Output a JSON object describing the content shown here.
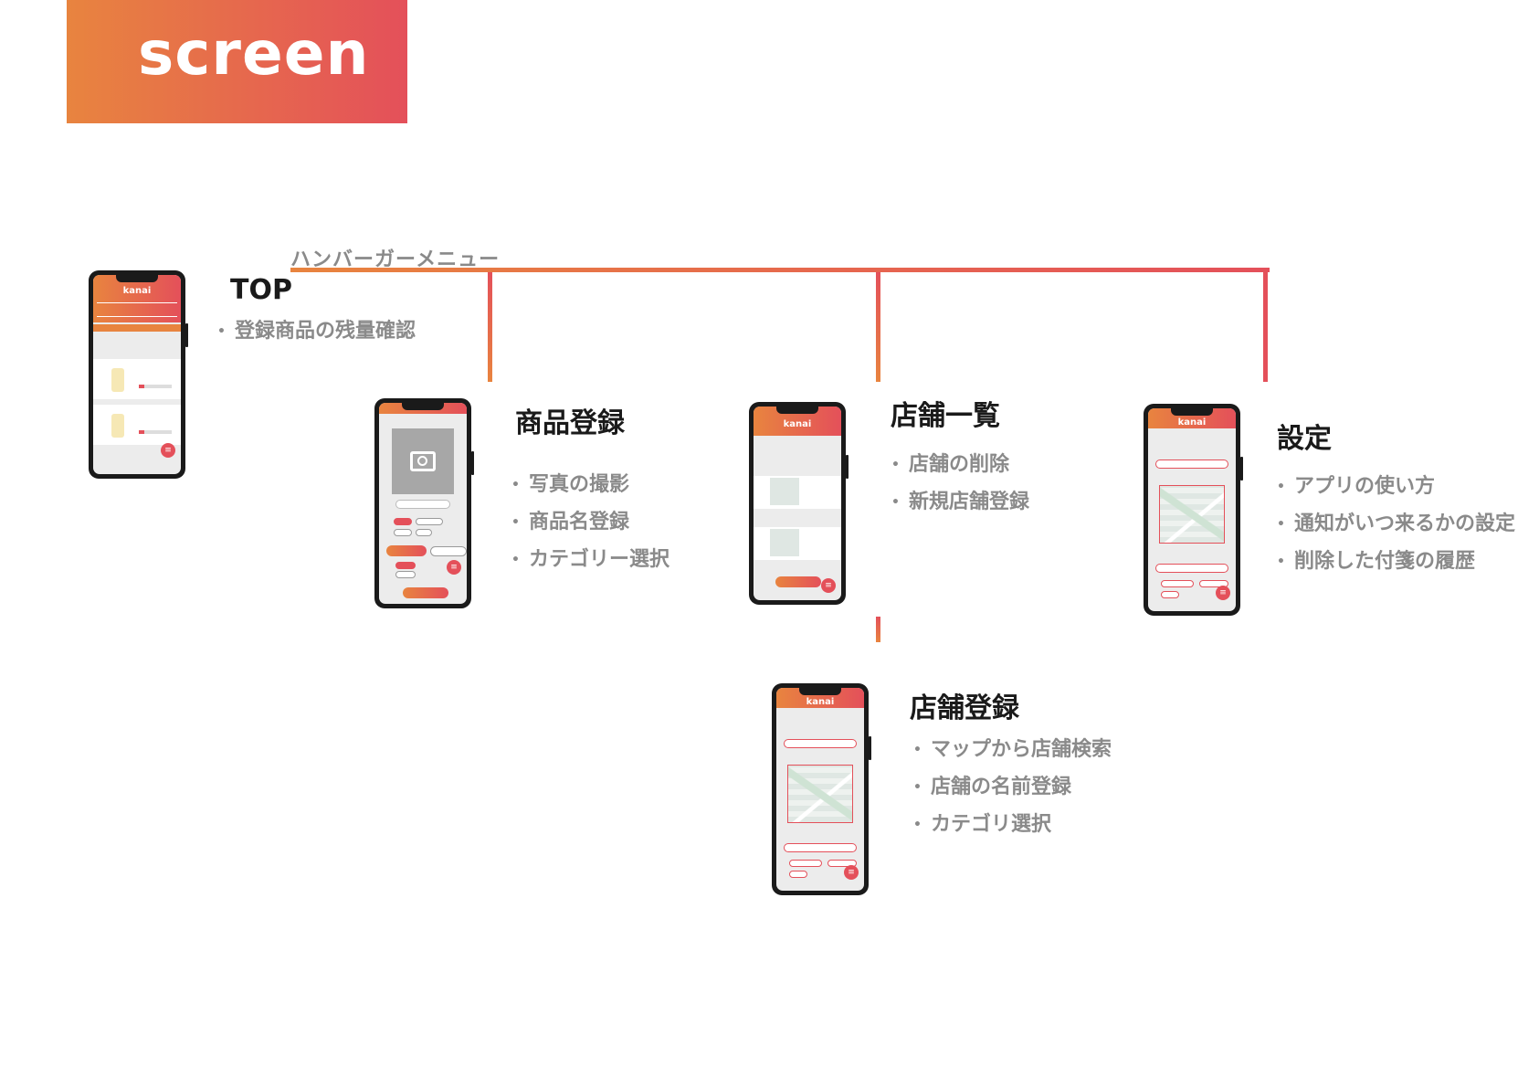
{
  "header": {
    "title": "screen"
  },
  "hamburger_menu_label": "ハンバーガーメニュー",
  "colors": {
    "accent_start": "#e8843f",
    "accent_end": "#e4505a",
    "text_gray": "#8a8a8a"
  },
  "app": {
    "logo": "kanai"
  },
  "screens": {
    "top": {
      "title": "TOP",
      "bullets": [
        "登録商品の残量確認"
      ]
    },
    "product_register": {
      "title": "商品登録",
      "bullets": [
        "写真の撮影",
        "商品名登録",
        "カテゴリー選択"
      ]
    },
    "store_list": {
      "title": "店舗一覧",
      "bullets": [
        "店舗の削除",
        "新規店舗登録"
      ]
    },
    "settings": {
      "title": "設定",
      "bullets": [
        "アプリの使い方",
        "通知がいつ来るかの設定",
        "削除した付箋の履歴"
      ]
    },
    "store_register": {
      "title": "店舗登録",
      "bullets": [
        "マップから店舗検索",
        "店舗の名前登録",
        "カテゴリ選択"
      ]
    }
  },
  "icons": {
    "menu": "menu-icon",
    "camera": "camera-icon",
    "search": "search-icon"
  }
}
